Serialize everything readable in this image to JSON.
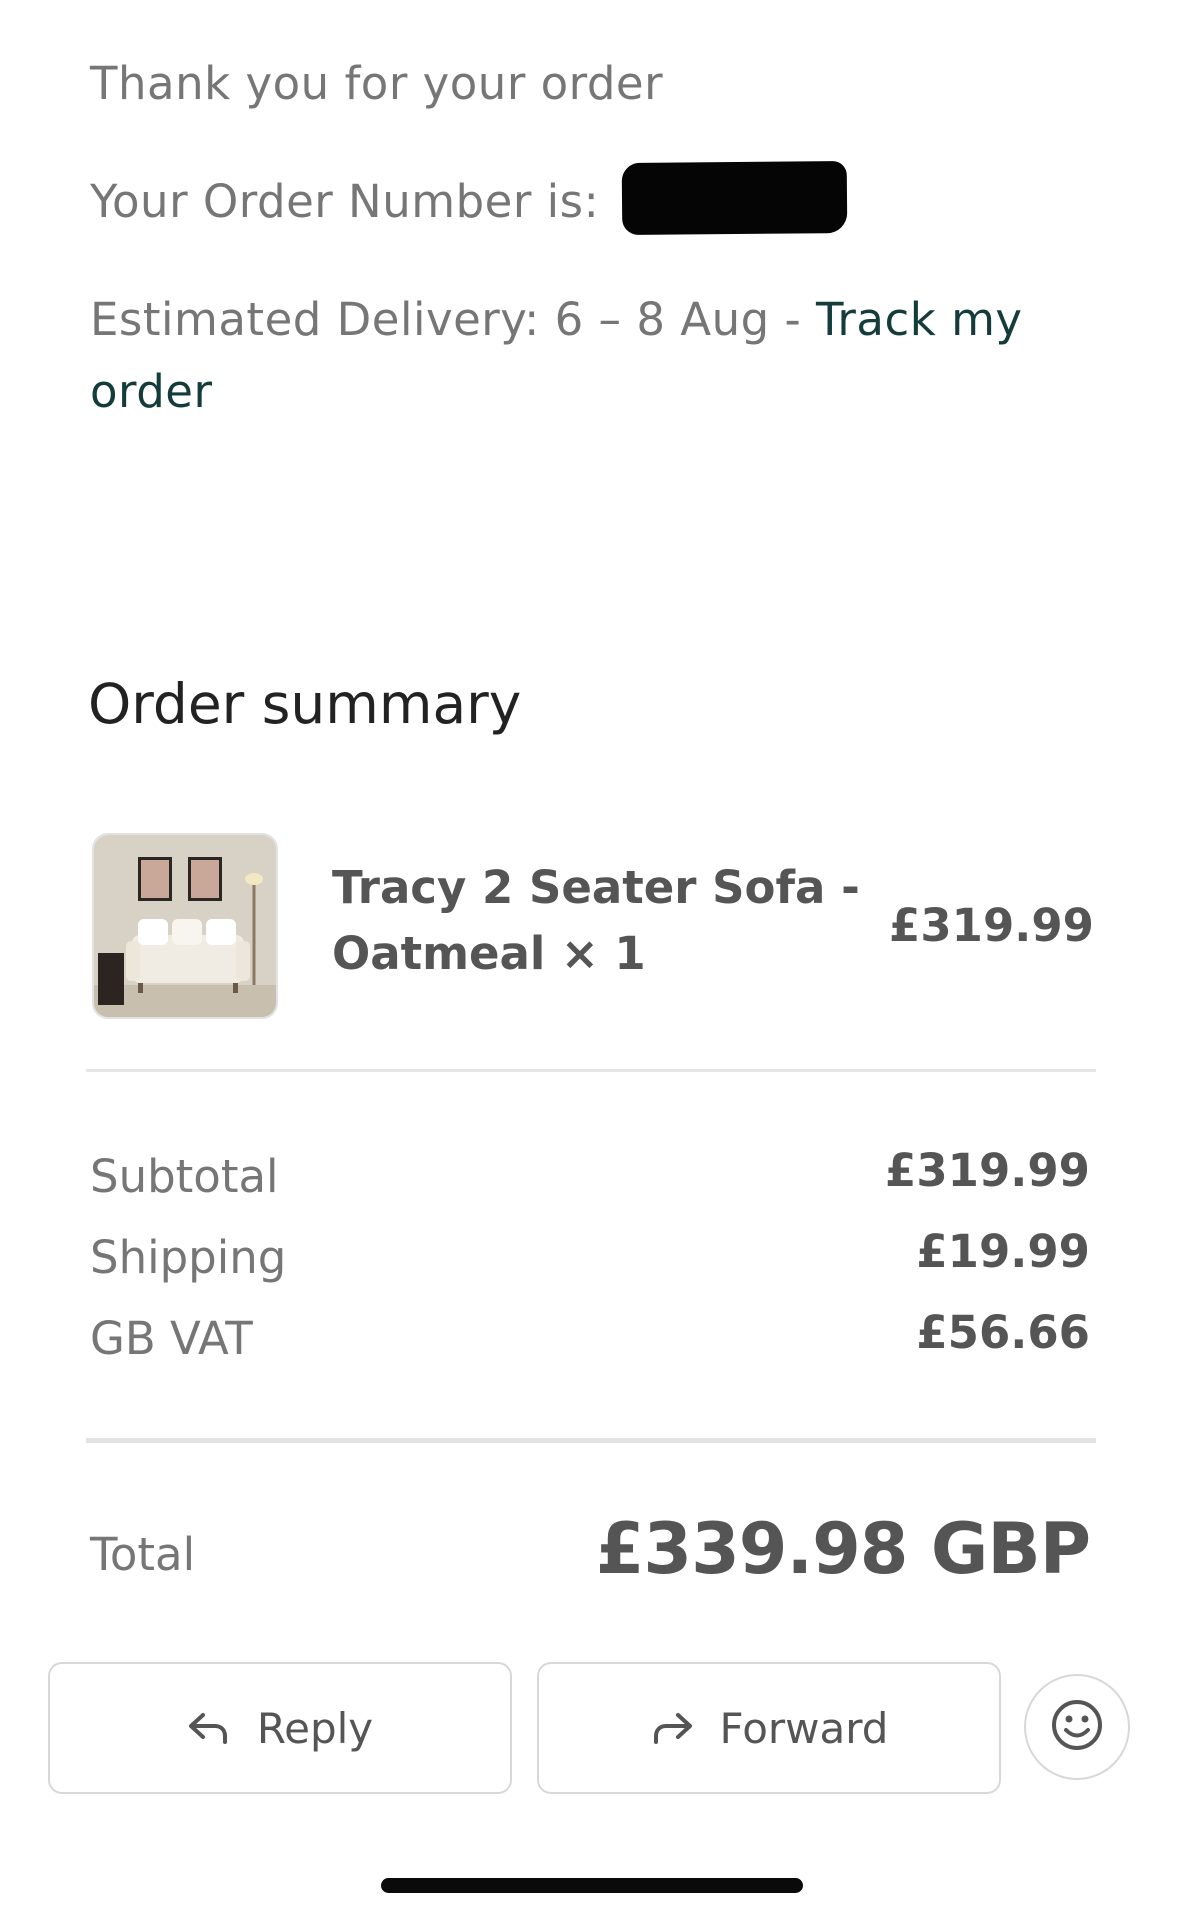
{
  "intro": {
    "thank_you": "Thank you for your order",
    "order_number_label": "Your Order Number is:",
    "delivery_label": "Estimated Delivery: 6 – 8 Aug -",
    "track_link": "Track my order"
  },
  "summary": {
    "title": "Order summary",
    "item": {
      "name": "Tracy 2 Seater Sofa - Oatmeal × 1",
      "price": "£319.99",
      "image": "sofa-product-thumbnail"
    },
    "rows": [
      {
        "label": "Subtotal",
        "value": "£319.99"
      },
      {
        "label": "Shipping",
        "value": "£19.99"
      },
      {
        "label": "GB VAT",
        "value": "£56.66"
      }
    ],
    "total_label": "Total",
    "total_value": "£339.98 GBP"
  },
  "actions": {
    "reply_label": "Reply",
    "forward_label": "Forward",
    "reply_icon": "reply-arrow-icon",
    "forward_icon": "forward-arrow-icon",
    "emoji_icon": "smiley-face-icon"
  },
  "colors": {
    "text_muted": "#767676",
    "text_strong": "#555555",
    "link": "#143c3a"
  }
}
